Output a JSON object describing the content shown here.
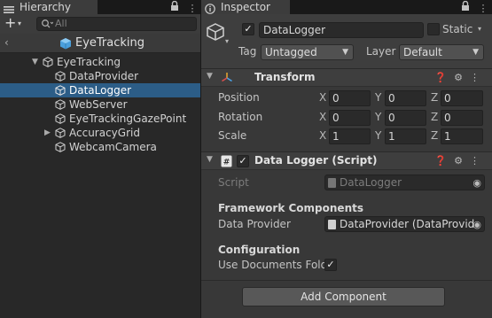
{
  "hierarchy": {
    "tab_title": "Hierarchy",
    "search_placeholder": "All",
    "scene_name": "EyeTracking",
    "tree": [
      {
        "label": "EyeTracking",
        "expanded": true,
        "depth": 0,
        "selected": false
      },
      {
        "label": "DataProvider",
        "depth": 1,
        "selected": false
      },
      {
        "label": "DataLogger",
        "depth": 1,
        "selected": true
      },
      {
        "label": "WebServer",
        "depth": 1,
        "selected": false
      },
      {
        "label": "EyeTrackingGazePoint",
        "depth": 1,
        "selected": false
      },
      {
        "label": "AccuracyGrid",
        "depth": 1,
        "has_children": true,
        "selected": false
      },
      {
        "label": "WebcamCamera",
        "depth": 1,
        "selected": false
      }
    ]
  },
  "inspector": {
    "tab_title": "Inspector",
    "object_name": "DataLogger",
    "active": true,
    "static_label": "Static",
    "static_checked": false,
    "tag_label": "Tag",
    "tag_value": "Untagged",
    "layer_label": "Layer",
    "layer_value": "Default",
    "transform": {
      "title": "Transform",
      "rows": [
        {
          "label": "Position",
          "x": "0",
          "y": "0",
          "z": "0"
        },
        {
          "label": "Rotation",
          "x": "0",
          "y": "0",
          "z": "0"
        },
        {
          "label": "Scale",
          "x": "1",
          "y": "1",
          "z": "1"
        }
      ],
      "axis_x": "X",
      "axis_y": "Y",
      "axis_z": "Z"
    },
    "script_component": {
      "title": "Data Logger (Script)",
      "enabled": true,
      "script_label": "Script",
      "script_value": "DataLogger",
      "section1_title": "Framework Components",
      "data_provider_label": "Data Provider",
      "data_provider_value": "DataProvider (DataProvid",
      "section2_title": "Configuration",
      "use_docs_label": "Use Documents Folde",
      "use_docs_checked": true
    },
    "add_component_label": "Add Component"
  },
  "colors": {
    "selection": "#2c5d87",
    "panel_bg": "#383838",
    "hierarchy_bg": "#282828",
    "transform_icon": "#e0a030",
    "cube_icon": "#5fb0e8"
  }
}
